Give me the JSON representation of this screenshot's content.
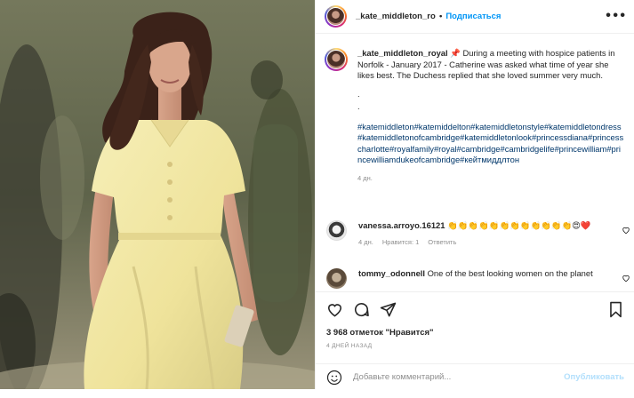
{
  "header": {
    "username": "_kate_middleton_royal",
    "separator": "•",
    "follow_label": "Подписаться",
    "more_icon": "more-horizontal-icon"
  },
  "caption": {
    "username": "_kate_middleton_royal",
    "pin": "📌",
    "text": "During a meeting with hospice patients in Norfolk - January 2017 - Catherine was asked what time of year she likes best. The Duchess replied that she loved summer very much.",
    "dot1": ".",
    "dot2": ".",
    "hashtags": "#katemiddleton#katemiddelton#katemiddletonstyle#katemiddletondress#katemiddletonofcambridge#katemiddletonlook#princessdiana#princesscharlotte#royalfamily#royal#cambridge#cambridgelife#princewilliam#princewilliamdukeofcambridge#кейтмиддлтон",
    "age": "4 дн."
  },
  "comments": [
    {
      "username": "vanessa.arroyo.16121",
      "text": "👏👏👏👏👏👏👏👏👏👏👏👏😍❤️",
      "age": "4 дн.",
      "like_label": "Нравится: 1",
      "reply_label": "Ответить"
    },
    {
      "username": "tommy_odonnell",
      "text": "One of the best looking women on the planet"
    }
  ],
  "actions": {
    "likes": "3 968 отметок \"Нравится\"",
    "time": "4 ДНЕЙ НАЗАД"
  },
  "add_comment": {
    "placeholder": "Добавьте комментарий...",
    "publish_label": "Опубликовать"
  },
  "colors": {
    "link": "#0095f6",
    "hashtag": "#00376b",
    "muted": "#8e8e8e",
    "publish_disabled": "#b2dffc",
    "dress": "#f3e9a6"
  }
}
